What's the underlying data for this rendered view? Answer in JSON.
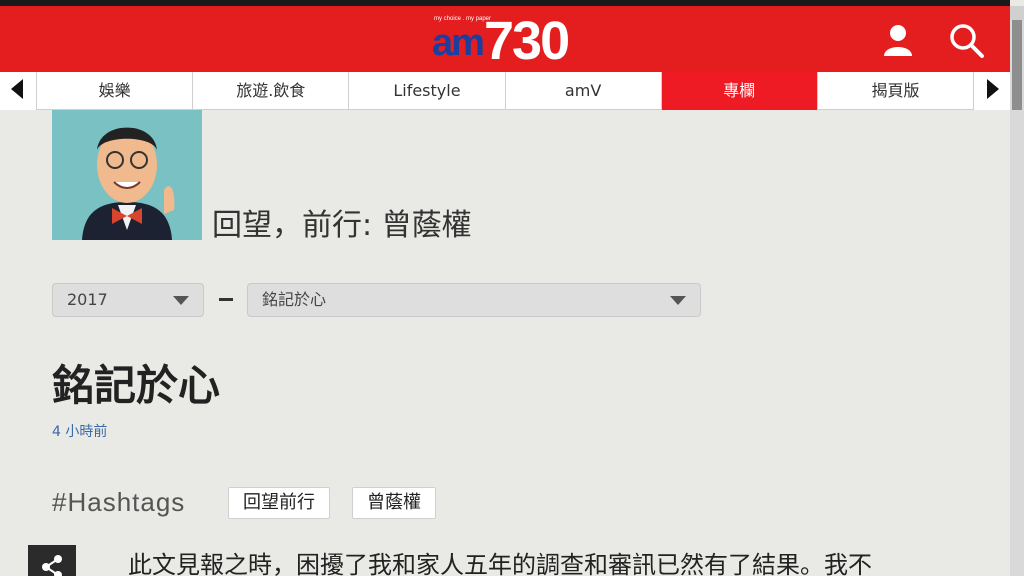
{
  "header": {
    "logo_tagline": "my choice . my paper",
    "logo_am": "am",
    "logo_number": "730",
    "user_icon": "user-icon",
    "search_icon": "search-icon",
    "brand_color": "#e41d1f"
  },
  "nav": {
    "tabs": [
      {
        "label": "娛樂",
        "active": false
      },
      {
        "label": "旅遊.飲食",
        "active": false
      },
      {
        "label": "Lifestyle",
        "active": false
      },
      {
        "label": "amV",
        "active": false
      },
      {
        "label": "專欄",
        "active": true
      },
      {
        "label": "揭頁版",
        "active": false
      }
    ],
    "left_arrow_icon": "chevron-left-icon",
    "right_arrow_icon": "chevron-right-icon",
    "active_color": "#ee1b24"
  },
  "column": {
    "title": "回望，前行: 曾蔭權"
  },
  "filters": {
    "year": "2017",
    "article": "銘記於心"
  },
  "article": {
    "title": "銘記於心",
    "timestamp": "4 小時前",
    "hashtags_label": "#Hashtags",
    "tags": [
      "回望前行",
      "曾蔭權"
    ],
    "body_first_line": "此文見報之時，困擾了我和家人五年的調查和審訊已然有了結果。我不"
  }
}
